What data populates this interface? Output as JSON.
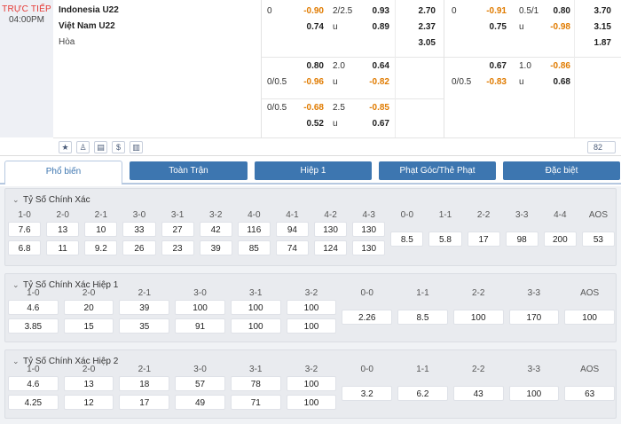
{
  "match": {
    "status": "TRỰC TIẾP",
    "kickoff": "04:00PM",
    "home": "Indonesia U22",
    "away": "Việt Nam U22",
    "draw": "Hòa"
  },
  "odds": {
    "full": [
      {
        "rows": [
          {
            "hcap": "0",
            "hval": "-0.90",
            "tlab": "2/2.5",
            "tval": "0.93",
            "x1": "2.70"
          },
          {
            "hcap": "",
            "hval": "0.74",
            "tlab": "u",
            "tval": "0.89",
            "x1": "2.37"
          },
          {
            "hcap": "",
            "hval": "",
            "tlab": "",
            "tval": "",
            "x1": "3.05"
          }
        ]
      },
      {
        "rows": [
          {
            "hcap": "",
            "hval": "0.80",
            "tlab": "2.0",
            "tval": "0.64",
            "x1": ""
          },
          {
            "hcap": "0/0.5",
            "hval": "-0.96",
            "tlab": "u",
            "tval": "-0.82",
            "x1": ""
          }
        ]
      },
      {
        "rows": [
          {
            "hcap": "0/0.5",
            "hval": "-0.68",
            "tlab": "2.5",
            "tval": "-0.85",
            "x1": ""
          },
          {
            "hcap": "",
            "hval": "0.52",
            "tlab": "u",
            "tval": "0.67",
            "x1": ""
          }
        ]
      }
    ],
    "half": [
      {
        "rows": [
          {
            "hcap": "0",
            "hval": "-0.91",
            "tlab": "0.5/1",
            "tval": "0.80",
            "x1": "3.70"
          },
          {
            "hcap": "",
            "hval": "0.75",
            "tlab": "u",
            "tval": "-0.98",
            "x1": "3.15"
          },
          {
            "hcap": "",
            "hval": "",
            "tlab": "",
            "tval": "",
            "x1": "1.87"
          }
        ]
      },
      {
        "rows": [
          {
            "hcap": "",
            "hval": "0.67",
            "tlab": "1.0",
            "tval": "-0.86",
            "x1": ""
          },
          {
            "hcap": "0/0.5",
            "hval": "-0.83",
            "tlab": "u",
            "tval": "0.68",
            "x1": ""
          }
        ]
      }
    ]
  },
  "tools": {
    "icons": [
      "star-icon",
      "lineup-icon",
      "stats-table-icon",
      "dollar-icon",
      "chart-bars-icon"
    ],
    "glyphs": [
      "★",
      "♙",
      "▤",
      "$",
      "▥"
    ],
    "market_count": "82"
  },
  "tabs": [
    {
      "label": "Phổ biến",
      "active": true
    },
    {
      "label": "Toàn Trận",
      "active": false
    },
    {
      "label": "Hiệp 1",
      "active": false
    },
    {
      "label": "Phạt Góc/Thẻ Phạt",
      "active": false
    },
    {
      "label": "Đặc biệt",
      "active": false
    }
  ],
  "sections": [
    {
      "title": "Tỷ Số Chính Xác",
      "home_win": {
        "labels": [
          "1-0",
          "2-0",
          "2-1",
          "3-0",
          "3-1",
          "3-2",
          "4-0",
          "4-1",
          "4-2",
          "4-3"
        ],
        "values": [
          "7.6",
          "13",
          "10",
          "33",
          "27",
          "42",
          "116",
          "94",
          "130",
          "130"
        ]
      },
      "away_win": {
        "labels": [
          "1-0",
          "2-0",
          "2-1",
          "3-0",
          "3-1",
          "3-2",
          "4-0",
          "4-1",
          "4-2",
          "4-3"
        ],
        "values": [
          "6.8",
          "11",
          "9.2",
          "26",
          "23",
          "39",
          "85",
          "74",
          "124",
          "130"
        ]
      },
      "draws": {
        "labels": [
          "0-0",
          "1-1",
          "2-2",
          "3-3",
          "4-4",
          "AOS"
        ],
        "values": [
          "8.5",
          "5.8",
          "17",
          "98",
          "200",
          "53"
        ]
      }
    },
    {
      "title": "Tỷ Số Chính Xác Hiệp 1",
      "home_win": {
        "labels": [
          "1-0",
          "2-0",
          "2-1",
          "3-0",
          "3-1",
          "3-2"
        ],
        "values": [
          "4.6",
          "20",
          "39",
          "100",
          "100",
          "100"
        ]
      },
      "away_win": {
        "labels": [
          "1-0",
          "2-0",
          "2-1",
          "3-0",
          "3-1",
          "3-2"
        ],
        "values": [
          "3.85",
          "15",
          "35",
          "91",
          "100",
          "100"
        ]
      },
      "draws": {
        "labels": [
          "0-0",
          "1-1",
          "2-2",
          "3-3",
          "AOS"
        ],
        "values": [
          "2.26",
          "8.5",
          "100",
          "170",
          "100"
        ]
      }
    },
    {
      "title": "Tỷ Số Chính Xác Hiệp 2",
      "home_win": {
        "labels": [
          "1-0",
          "2-0",
          "2-1",
          "3-0",
          "3-1",
          "3-2"
        ],
        "values": [
          "4.6",
          "13",
          "18",
          "57",
          "78",
          "100"
        ]
      },
      "away_win": {
        "labels": [
          "1-0",
          "2-0",
          "2-1",
          "3-0",
          "3-1",
          "3-2"
        ],
        "values": [
          "4.25",
          "12",
          "17",
          "49",
          "71",
          "100"
        ]
      },
      "draws": {
        "labels": [
          "0-0",
          "1-1",
          "2-2",
          "3-3",
          "AOS"
        ],
        "values": [
          "3.2",
          "6.2",
          "43",
          "100",
          "63"
        ]
      }
    }
  ]
}
